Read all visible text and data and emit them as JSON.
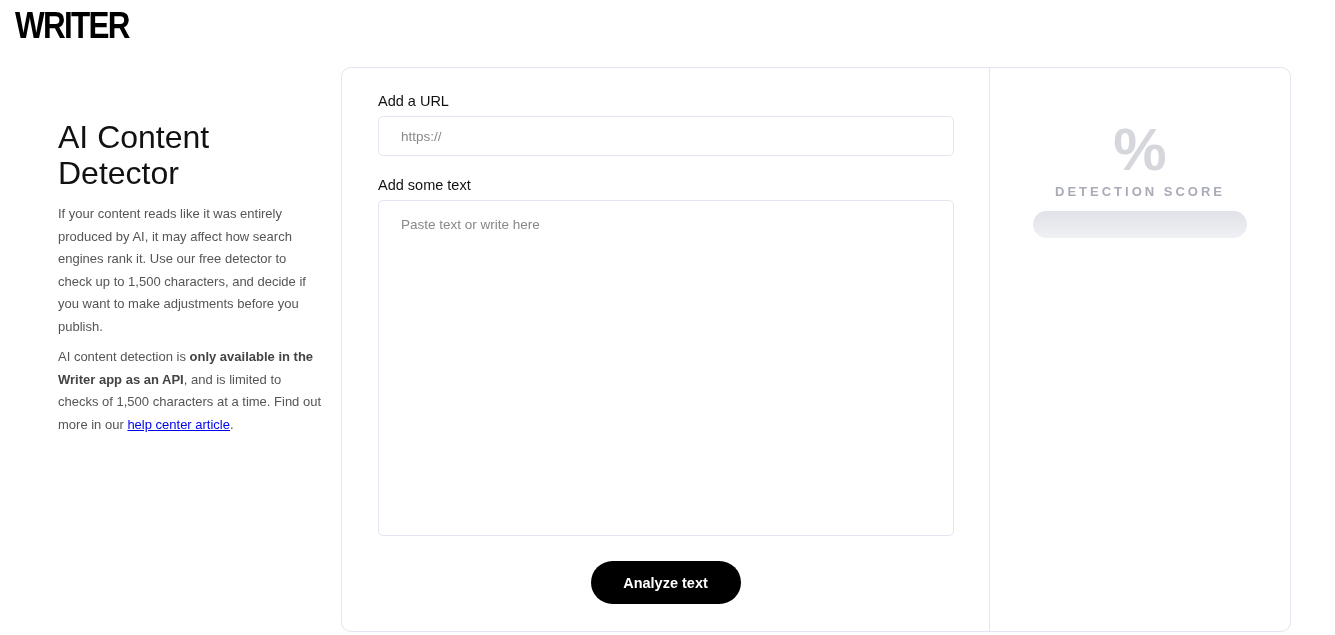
{
  "logo": "WRITER",
  "intro": {
    "title": "AI Content Detector",
    "paragraphs": [
      "If your content reads like it was entirely produced by AI, it may affect how search engines rank it. Use our free detector to check up to 1,500 characters, and decide if you want to make adjustments before you publish.",
      "AI content detection is **only available in the Writer app as an API**, and is limited to checks of 1,500 characters at a time. Find out more in our"
    ],
    "link": "help center article",
    "link_after": "."
  },
  "form": {
    "url_label": "Add a URL",
    "url_placeholder": "https://",
    "text_label": "Add some text",
    "text_placeholder": "Paste text or write here",
    "button": "Analyze text"
  },
  "score": {
    "symbol": "%",
    "label": "DETECTION SCORE"
  }
}
